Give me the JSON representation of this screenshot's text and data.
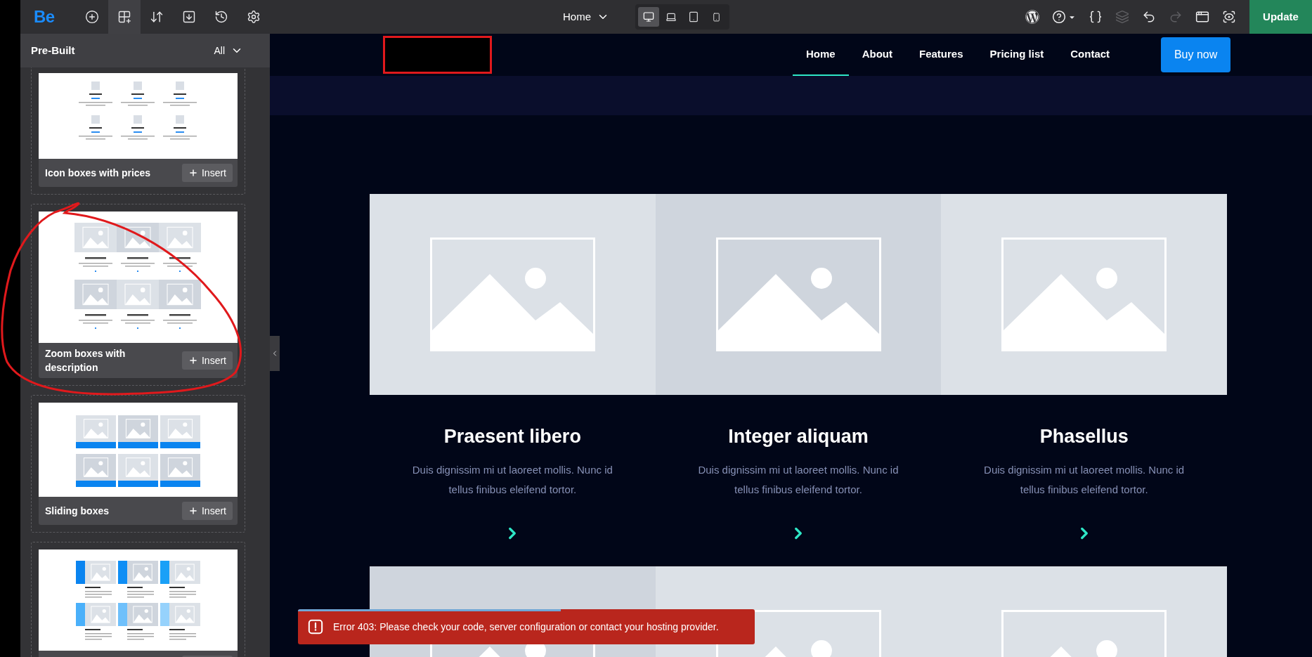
{
  "toolbar": {
    "logo": "Be",
    "tools": [
      {
        "kind": "add",
        "selected": false
      },
      {
        "kind": "prebuilt",
        "selected": true
      },
      {
        "kind": "sort",
        "selected": false
      },
      {
        "kind": "export",
        "selected": false
      },
      {
        "kind": "history",
        "selected": false
      },
      {
        "kind": "settings",
        "selected": false
      }
    ],
    "page_selector": "Home",
    "devices": [
      {
        "kind": "desktop",
        "selected": true
      },
      {
        "kind": "laptop",
        "selected": false
      },
      {
        "kind": "tablet",
        "selected": false
      },
      {
        "kind": "phone",
        "selected": false
      }
    ],
    "actions": [
      {
        "kind": "wordpress",
        "disabled": false
      },
      {
        "kind": "help",
        "disabled": false
      },
      {
        "kind": "css",
        "disabled": false
      },
      {
        "kind": "layers",
        "disabled": true
      },
      {
        "kind": "undo",
        "disabled": false
      },
      {
        "kind": "redo",
        "disabled": true
      },
      {
        "kind": "open-window",
        "disabled": false
      },
      {
        "kind": "preview",
        "disabled": false
      }
    ],
    "update_button": "Update"
  },
  "sidebar": {
    "title": "Pre-Built",
    "filter": "All",
    "cards": [
      {
        "kind": "price-icons",
        "title": "Icon boxes with prices",
        "insert": "Insert"
      },
      {
        "kind": "zoom",
        "title": "Zoom boxes with description",
        "insert": "Insert"
      },
      {
        "kind": "sliding",
        "title": "Sliding boxes",
        "insert": "Insert"
      },
      {
        "kind": "icon-side"
      }
    ]
  },
  "canvas": {
    "nav": [
      {
        "label": "Home",
        "selected": true
      },
      {
        "label": "About",
        "selected": false
      },
      {
        "label": "Features",
        "selected": false
      },
      {
        "label": "Pricing list",
        "selected": false
      },
      {
        "label": "Contact",
        "selected": false
      }
    ],
    "buy_button": "Buy now",
    "boxes": [
      {
        "title": "Praesent libero",
        "description": "Duis dignissim mi ut laoreet mollis. Nunc id tellus finibus eleifend tortor."
      },
      {
        "title": "Integer aliquam",
        "description": "Duis dignissim mi ut laoreet mollis. Nunc id tellus finibus eleifend tortor."
      },
      {
        "title": "Phasellus",
        "description": "Duis dignissim mi ut laoreet mollis. Nunc id tellus finibus eleifend tortor."
      }
    ],
    "lower_boxes": [
      {
        "kind": "image"
      },
      {
        "kind": "image"
      },
      {
        "kind": "image"
      }
    ]
  },
  "toast": {
    "message": "Error 403: Please check your code, server configuration or contact your hosting provider.",
    "level": 0.575
  }
}
